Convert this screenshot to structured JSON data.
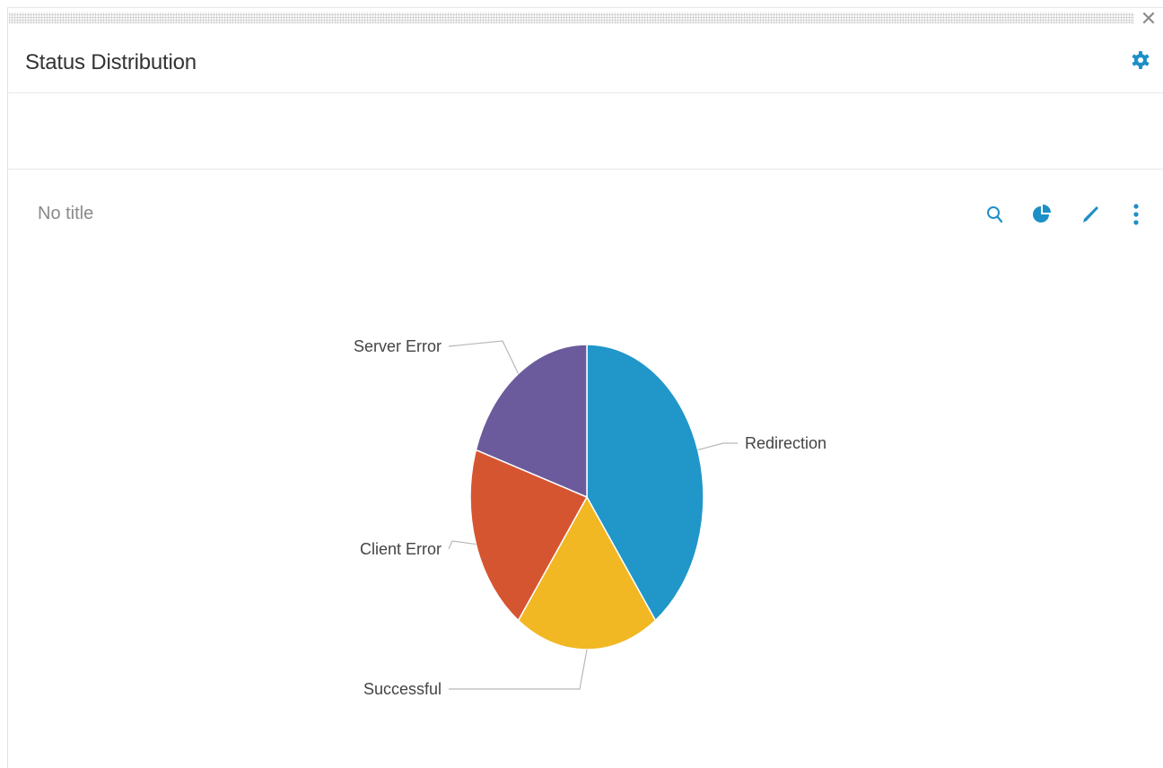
{
  "widget": {
    "title": "Status Distribution",
    "close_icon": "close-icon",
    "settings_icon": "gear-icon"
  },
  "chart_panel": {
    "title": "No title",
    "toolbar": [
      {
        "icon": "search-icon",
        "name": "zoom-button"
      },
      {
        "icon": "pie-chart-icon",
        "name": "chart-type-button"
      },
      {
        "icon": "pencil-icon",
        "name": "edit-button"
      },
      {
        "icon": "more-vertical-icon",
        "name": "more-button"
      }
    ]
  },
  "colors": {
    "accent": "#1e8fc6",
    "redirection": "#2196c9",
    "successful": "#f1b824",
    "client_error": "#d65531",
    "server_error": "#6b5b9c"
  },
  "chart_data": {
    "type": "pie",
    "title": "No title",
    "slices": [
      {
        "label": "Redirection",
        "value": 40,
        "color": "#2196c9"
      },
      {
        "label": "Successful",
        "value": 20,
        "color": "#f1b824"
      },
      {
        "label": "Client Error",
        "value": 20,
        "color": "#d65531"
      },
      {
        "label": "Server Error",
        "value": 20,
        "color": "#6b5b9c"
      }
    ]
  }
}
